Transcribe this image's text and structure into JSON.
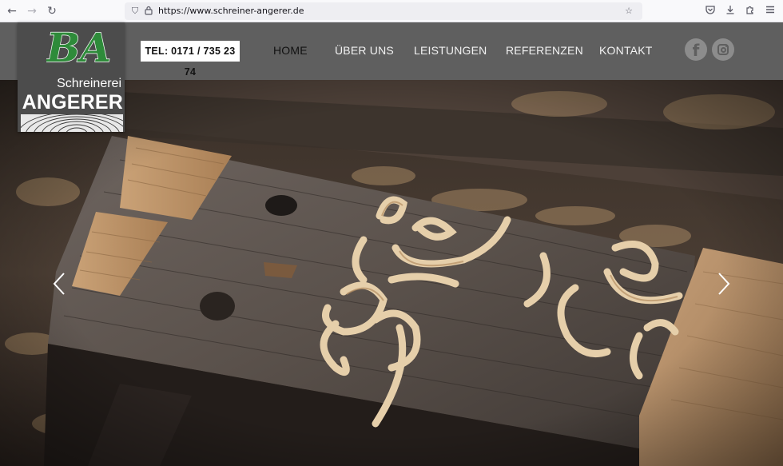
{
  "browser": {
    "back_icon": "arrow-left-icon",
    "forward_icon": "arrow-right-icon",
    "reload_icon": "reload-icon",
    "url": "https://www.schreiner-angerer.de",
    "icons": [
      "shield-icon",
      "lock-icon",
      "star-icon",
      "pocket-icon",
      "download-icon",
      "extensions-icon",
      "menu-icon"
    ]
  },
  "logo": {
    "monogram": "BA",
    "subtitle": "Schreinerei",
    "name": "ANGERER",
    "monogram_color": "#2e8b3a"
  },
  "header": {
    "phone": "TEL: 0171 / 735 23 74",
    "nav": [
      {
        "label": "HOME",
        "active": true
      },
      {
        "label": "ÜBER UNS",
        "active": false
      },
      {
        "label": "LEISTUNGEN",
        "active": false
      },
      {
        "label": "REFERENZEN",
        "active": false
      },
      {
        "label": "KONTAKT",
        "active": false
      }
    ],
    "social": [
      "facebook-icon",
      "instagram-icon"
    ]
  },
  "hero": {
    "image": "wood-shavings-on-workbench",
    "prev_icon": "chevron-left-icon",
    "next_icon": "chevron-right-icon"
  },
  "colors": {
    "header_bg": "#5f5f5f",
    "logo_bg": "#4c4c4c",
    "accent_green": "#2e8b3a"
  }
}
